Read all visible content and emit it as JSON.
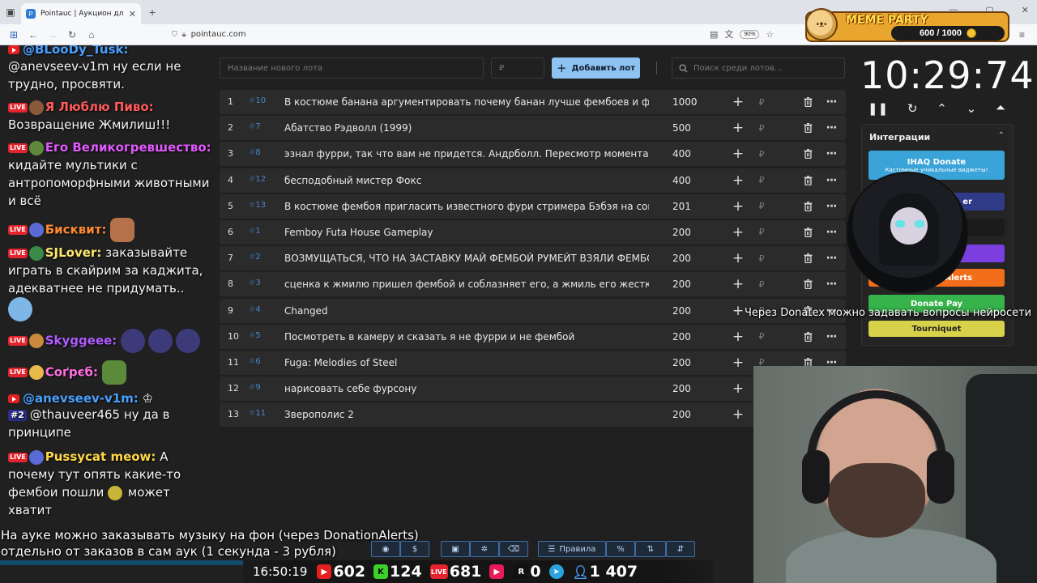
{
  "browser": {
    "tab_title": "Pointauc | Аукцион для стримеров",
    "url": "pointauc.com",
    "zoom": "90%",
    "new_tab": "+"
  },
  "meme_party": {
    "title": "MEME PARTY",
    "progress_text": "600 / 1000",
    "progress_value": 600,
    "progress_max": 1000
  },
  "chat": {
    "messages": [
      {
        "badge": "youtube",
        "user": "@BLooDy_Tusk:",
        "text": "",
        "color": "u-blue"
      },
      {
        "badge": "",
        "user": "",
        "text": "@anevseev-v1m ну если не трудно, просвяти.",
        "color": ""
      },
      {
        "badge": "live",
        "user": "Я Люблю Пиво:",
        "text": "Возвращение Жмилиш!!!",
        "color": "u-red"
      },
      {
        "badge": "live",
        "user": "Его Великогревшество:",
        "text": "кидайте мультики с антропоморфными животными и всё",
        "color": "u-pink"
      },
      {
        "badge": "live",
        "user": "Бисквит:",
        "text": "",
        "color": "u-orange"
      },
      {
        "badge": "live",
        "user": "SJLover:",
        "text": "заказывайте играть в скайрим за каджита, адекватнее не придумать..",
        "color": "u-green"
      },
      {
        "badge": "live",
        "user": "Skyggeee:",
        "text": "",
        "color": "u-purple"
      },
      {
        "badge": "live",
        "user": "Ϲоґрєб:",
        "text": "",
        "color": "u-magenta"
      },
      {
        "badge": "youtube",
        "user": "@anevseev-v1m:",
        "text": "",
        "color": "u-blue"
      },
      {
        "badge": "#2",
        "user": "",
        "text": "@thauveer465 ну да в принципе",
        "color": ""
      },
      {
        "badge": "live",
        "user": "Pussycat meow:",
        "text": "А почему тут опять какие-то фембои пошли",
        "text2": "может хватит",
        "color": "u-yellow"
      }
    ]
  },
  "auction": {
    "new_lot_placeholder": "Название нового лота",
    "amount_placeholder": "₽",
    "add_button": "Добавить лот",
    "search_placeholder": "Поиск среди лотов...",
    "lots": [
      {
        "n": "1",
        "id": "10",
        "name": "В костюме банана аргументировать почему банан лучше фембоев и фурри",
        "amount": "1000"
      },
      {
        "n": "2",
        "id": "7",
        "name": "Абатство Рэдволл (1999)",
        "amount": "500"
      },
      {
        "n": "3",
        "id": "8",
        "name": "эзнал фурри, так что вам не придется. Андрболл. Пересмотр момента с айрон",
        "amount": "400"
      },
      {
        "n": "4",
        "id": "12",
        "name": "бесподобный мистер Фокс",
        "amount": "400"
      },
      {
        "n": "5",
        "id": "13",
        "name": "В костюме фембоя пригласить известного фури стримера Бэбэя на совместнс",
        "amount": "201"
      },
      {
        "n": "6",
        "id": "1",
        "name": "Femboy Futa House Gameplay",
        "amount": "200"
      },
      {
        "n": "7",
        "id": "2",
        "name": "ВОЗМУЩАТЬСЯ, ЧТО НА ЗАСТАВКУ МАЙ ФЕМБОЙ РУМЕЙТ ВЗЯЛИ ФЕМБОЙ",
        "amount": "200"
      },
      {
        "n": "8",
        "id": "3",
        "name": "сценка к жмилю пришел фембой и соблазняет его, а жмиль его жестко пизди",
        "amount": "200"
      },
      {
        "n": "9",
        "id": "4",
        "name": "Changed",
        "amount": "200"
      },
      {
        "n": "10",
        "id": "5",
        "name": "Посмотреть в камеру и сказать я не фурри и не фембой",
        "amount": "200"
      },
      {
        "n": "11",
        "id": "6",
        "name": "Fuga: Melodies of Steel",
        "amount": "200"
      },
      {
        "n": "12",
        "id": "9",
        "name": "нарисовать себе фурсону",
        "amount": "200"
      },
      {
        "n": "13",
        "id": "11",
        "name": "Зверополис 2",
        "amount": "200"
      }
    ],
    "rules_button": "Правила"
  },
  "timer": {
    "value": "10:29:74"
  },
  "integrations": {
    "title": "Интеграции",
    "buttons": [
      {
        "label": "IHAQ Donate",
        "sub": "Кастомные уникальные виджеты!",
        "color": "#3aa3d8"
      },
      {
        "label": "er",
        "color": "#2f3b88"
      },
      {
        "label": "",
        "color": "#1b1b1b"
      },
      {
        "label": "",
        "color": "#7b3fe0"
      },
      {
        "label": "Alerts",
        "color": "#f36e1a"
      },
      {
        "label": "Donate Pay",
        "color": "#36b34a"
      },
      {
        "label": "Tourniquet",
        "color": "#d8d24a"
      }
    ]
  },
  "captions": {
    "right": "Через Donatex можно задавать вопросы нейросети",
    "bottom1": "На ауке можно заказывать музыку на фон (через DonationAlerts)",
    "bottom2": "отдельно от заказов в сам аук (1 секунда - 3 рубля)"
  },
  "stats": {
    "clock": "16:50:19",
    "youtube": "602",
    "kick": "124",
    "live": "681",
    "rumble": "0",
    "telegram": "1 407"
  }
}
